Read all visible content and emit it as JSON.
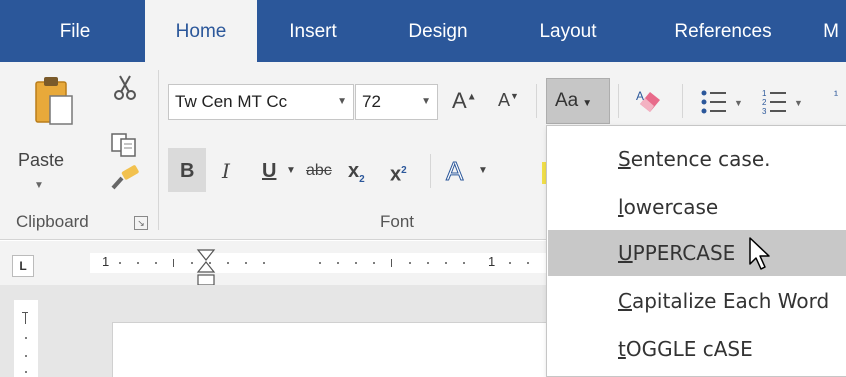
{
  "tabs": [
    {
      "label": "File",
      "active": false
    },
    {
      "label": "Home",
      "active": true
    },
    {
      "label": "Insert",
      "active": false
    },
    {
      "label": "Design",
      "active": false
    },
    {
      "label": "Layout",
      "active": false
    },
    {
      "label": "References",
      "active": false
    },
    {
      "label": "M",
      "active": false
    }
  ],
  "clipboard": {
    "paste_label": "Paste",
    "group_label": "Clipboard"
  },
  "font": {
    "group_label": "Font",
    "font_name": "Tw Cen MT Cc",
    "font_size": "72",
    "grow_label": "A",
    "shrink_label": "A",
    "change_case_label": "Aa",
    "bold": "B",
    "italic": "I",
    "underline": "U",
    "strike": "abc",
    "subscript": "x",
    "subscript_mark": "2",
    "superscript": "x",
    "superscript_mark": "2",
    "effects": "A"
  },
  "ruler": {
    "marks": [
      "1",
      "1"
    ]
  },
  "change_case_menu": {
    "items": [
      {
        "key": "S",
        "rest": "entence case.",
        "highlighted": false
      },
      {
        "key": "l",
        "rest": "owercase",
        "highlighted": false
      },
      {
        "key": "U",
        "rest": "PPERCASE",
        "highlighted": true
      },
      {
        "key": "C",
        "rest": "apitalize Each Word",
        "highlighted": false
      },
      {
        "key": "t",
        "rest": "OGGLE cASE",
        "highlighted": false
      }
    ]
  },
  "colors": {
    "tabbar": "#2b579a",
    "ribbon": "#f3f3f3",
    "highlight": "#c8c8c8"
  }
}
